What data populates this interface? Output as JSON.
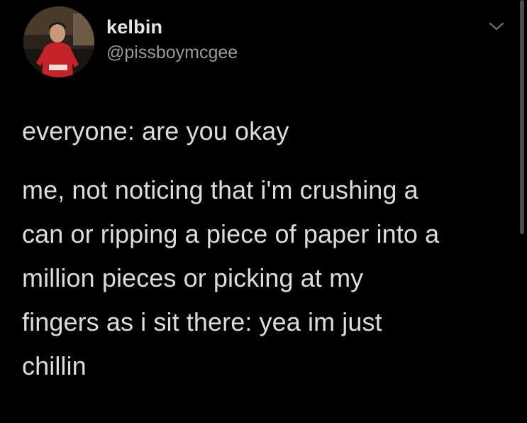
{
  "author": {
    "display_name": "kelbin",
    "handle": "@pissboymcgee"
  },
  "icons": {
    "menu": "chevron-down-icon",
    "avatar": "profile-photo"
  },
  "tweet": {
    "line1": "everyone: are you okay",
    "lines": [
      "me, not noticing that i'm crushing a",
      "can or ripping a piece of paper into a",
      "million pieces or picking at my",
      "fingers as i sit there: yea im just",
      "chillin"
    ]
  },
  "colors": {
    "background": "#000000",
    "text": "#dcdcdc",
    "handle": "#9a9a9a"
  }
}
